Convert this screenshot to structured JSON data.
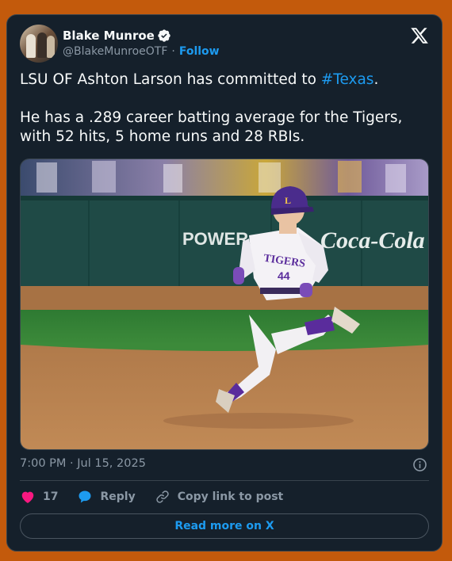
{
  "author": {
    "display_name": "Blake Munroe",
    "handle": "@BlakeMunroeOTF",
    "separator": "·",
    "follow_label": "Follow",
    "verified": true
  },
  "tweet": {
    "text_before_tag": "LSU OF Ashton Larson has committed to ",
    "hashtag": "#Texas",
    "text_after_tag": ".\n\nHe has a .289 career batting average for the Tigers, with 52 hits, 5 home runs and 28 RBIs.",
    "timestamp": "7:00 PM · Jul 15, 2025"
  },
  "media": {
    "wall_ad_left": "POWER",
    "wall_ad_right": "Coca-Cola",
    "jersey_text": "TIGERS",
    "jersey_number": "44"
  },
  "actions": {
    "likes_count": "17",
    "reply_label": "Reply",
    "copy_link_label": "Copy link to post"
  },
  "read_more_label": "Read more on X",
  "colors": {
    "accent": "#1d9bf0",
    "card_bg": "#15202b",
    "page_bg": "#c35a0c",
    "like": "#f91880",
    "muted": "#8b98a5"
  },
  "icons": [
    "verified-badge-icon",
    "x-logo-icon",
    "info-icon",
    "heart-icon",
    "reply-bubble-icon",
    "link-icon"
  ]
}
